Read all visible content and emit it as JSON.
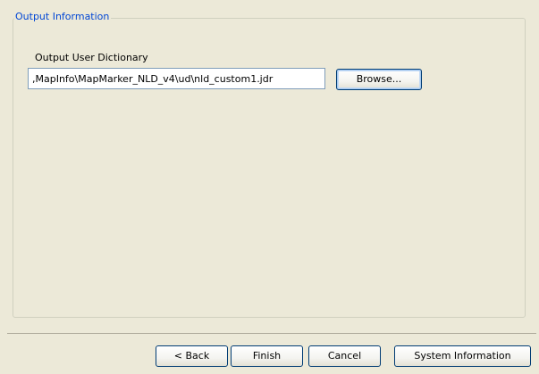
{
  "group": {
    "title": "Output Information"
  },
  "output_dictionary": {
    "label": "Output User Dictionary",
    "value": ",MapInfo\\MapMarker_NLD_v4\\ud\\nld_custom1.jdr",
    "browse_label": "Browse..."
  },
  "footer": {
    "back_label": "< Back",
    "finish_label": "Finish",
    "cancel_label": "Cancel",
    "sysinfo_label": "System Information"
  },
  "colors": {
    "window_bg": "#ece9d8",
    "group_title": "#0046d5",
    "button_border": "#003c74",
    "input_border": "#7f9db9"
  }
}
